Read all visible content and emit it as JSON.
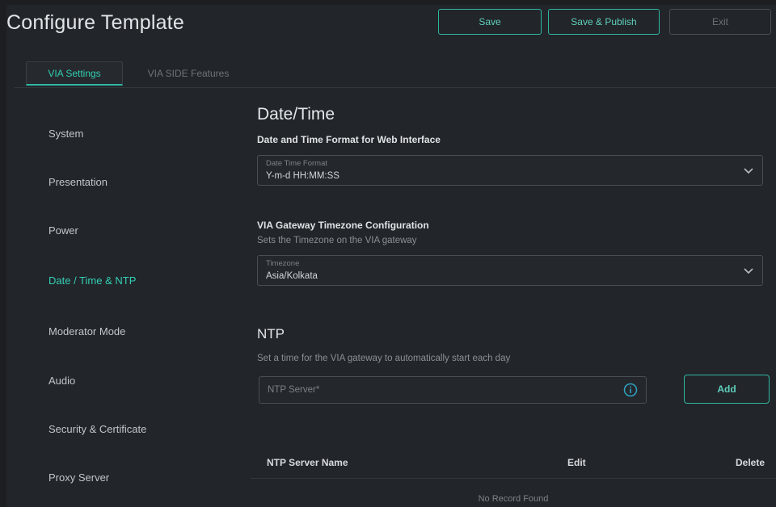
{
  "header": {
    "title": "Configure Template",
    "buttons": {
      "save": "Save",
      "save_publish": "Save & Publish",
      "exit": "Exit"
    }
  },
  "tabs": [
    {
      "label": "VIA Settings",
      "active": true
    },
    {
      "label": "VIA SIDE Features",
      "active": false
    }
  ],
  "sidebar": {
    "items": [
      {
        "label": "System"
      },
      {
        "label": "Presentation"
      },
      {
        "label": "Power"
      },
      {
        "label": "Date / Time & NTP",
        "active": true
      },
      {
        "label": "Moderator Mode"
      },
      {
        "label": "Audio"
      },
      {
        "label": "Security & Certificate"
      },
      {
        "label": "Proxy Server"
      }
    ]
  },
  "datetime": {
    "section_title": "Date/Time",
    "format_heading": "Date and Time Format for Web Interface",
    "format_field": {
      "label": "Date Time Format",
      "value": "Y-m-d HH:MM:SS",
      "icon": "chevron-down-icon"
    },
    "tz_heading": "VIA Gateway Timezone Configuration",
    "tz_sub": "Sets the Timezone on the VIA gateway",
    "tz_field": {
      "label": "Timezone",
      "value": "Asia/Kolkata",
      "icon": "chevron-down-icon"
    }
  },
  "ntp": {
    "title": "NTP",
    "sub": "Set a time for the VIA gateway to automatically start each day",
    "input_placeholder": "NTP Server*",
    "info_icon": "info-icon",
    "add_label": "Add",
    "table": {
      "columns": [
        "NTP Server Name",
        "Edit",
        "Delete"
      ],
      "empty_text": "No Record Found"
    }
  },
  "colors": {
    "accent": "#2fb7a4",
    "accent_text": "#33d0b6",
    "background": "#222529"
  }
}
